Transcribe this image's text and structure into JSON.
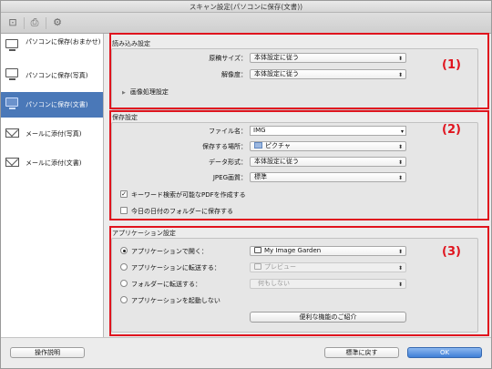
{
  "window": {
    "title": "スキャン設定(パソコンに保存(文書))"
  },
  "toolbar": {
    "icons": [
      "scan-icon",
      "printer-icon",
      "settings-icon"
    ]
  },
  "sidebar": {
    "items": [
      {
        "label": "パソコンに保存(おまかせ)",
        "icon": "computer-icon",
        "active": false
      },
      {
        "label": "パソコンに保存(写真)",
        "icon": "computer-icon",
        "active": false
      },
      {
        "label": "パソコンに保存(文書)",
        "icon": "computer-icon",
        "active": true
      },
      {
        "label": "メールに添付(写真)",
        "icon": "mail-icon",
        "active": false
      },
      {
        "label": "メールに添付(文書)",
        "icon": "mail-icon",
        "active": false
      }
    ]
  },
  "scan_settings": {
    "title": "読み込み設定",
    "marker": "(1)",
    "paper_size_label": "原稿サイズ：",
    "paper_size_value": "本体設定に従う",
    "resolution_label": "解像度：",
    "resolution_value": "本体設定に従う",
    "image_processing_label": "画像処理設定"
  },
  "save_settings": {
    "title": "保存設定",
    "marker": "(2)",
    "filename_label": "ファイル名：",
    "filename_value": "IMG",
    "location_label": "保存する場所：",
    "location_value": "ピクチャ",
    "format_label": "データ形式：",
    "format_value": "本体設定に従う",
    "jpeg_label": "JPEG画質：",
    "jpeg_value": "標準",
    "keyword_pdf_label": "キーワード検索が可能なPDFを作成する",
    "keyword_pdf_checked": true,
    "date_folder_label": "今日の日付のフォルダーに保存する",
    "date_folder_checked": false
  },
  "app_settings": {
    "title": "アプリケーション設定",
    "marker": "(3)",
    "open_with_label": "アプリケーションで開く：",
    "open_with_value": "My Image Garden",
    "send_to_app_label": "アプリケーションに転送する：",
    "send_to_app_value": "プレビュー",
    "send_to_folder_label": "フォルダーに転送する：",
    "send_to_folder_value": "何もしない",
    "no_launch_label": "アプリケーションを起動しない",
    "more_functions_label": "便利な機能のご紹介",
    "selected_option": "open_with"
  },
  "footer": {
    "instructions_label": "操作説明",
    "defaults_label": "標準に戻す",
    "ok_label": "OK"
  },
  "colors": {
    "accent": "#4a78b8",
    "marker": "#e0141e",
    "ok_button": "#3f7fd6"
  }
}
